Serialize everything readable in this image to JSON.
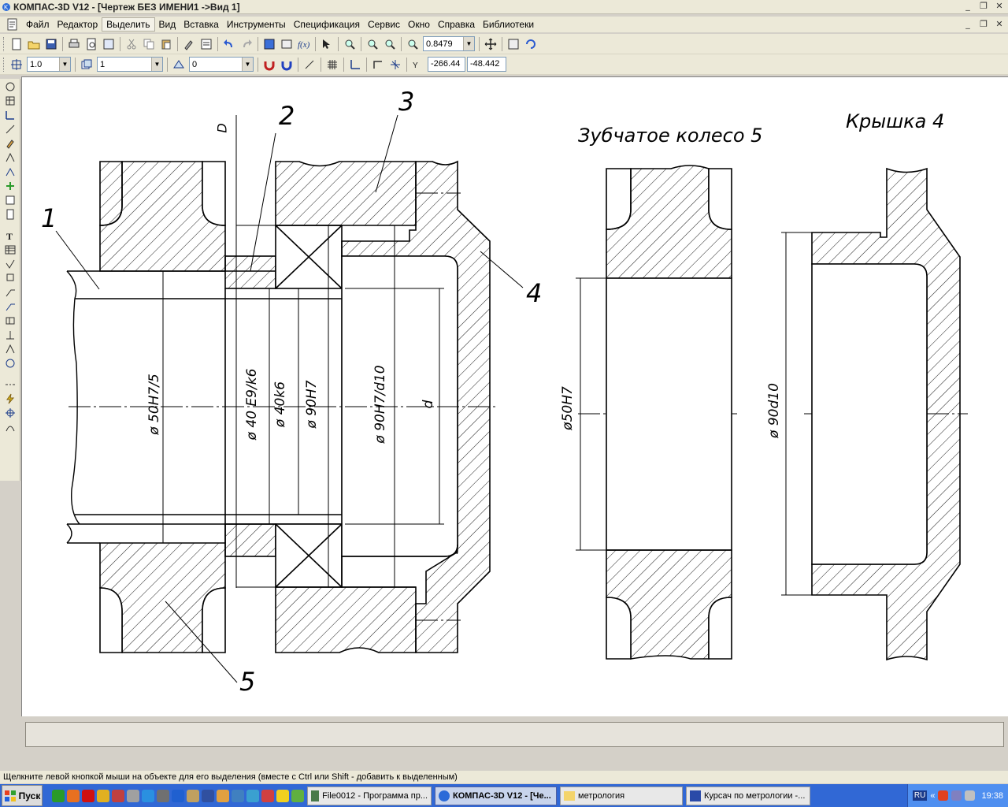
{
  "window": {
    "title": "КОМПАС-3D V12 - [Чертеж БЕЗ ИМЕНИ1 ->Вид 1]"
  },
  "menu": {
    "items": [
      "Файл",
      "Редактор",
      "Выделить",
      "Вид",
      "Вставка",
      "Инструменты",
      "Спецификация",
      "Сервис",
      "Окно",
      "Справка",
      "Библиотеки"
    ],
    "active_index": 2
  },
  "toolbar1": {
    "zoom_value": "0.8479"
  },
  "toolbar2": {
    "scale_value": "1.0",
    "layer_value": "1",
    "style_value": "0",
    "coord_x": "-266.44",
    "coord_y": "-48.442"
  },
  "drawing": {
    "callouts": [
      "1",
      "2",
      "3",
      "4",
      "5",
      "D"
    ],
    "dimensions_main": [
      "ø 50H7/5",
      "ø 40 E9/k6",
      "ø 40k6",
      "ø 90H7",
      "ø 90H7/d10",
      "d"
    ],
    "gear_title": "Зубчатое колесо 5",
    "gear_dimension": "ø50H7",
    "cover_title": "Крышка 4",
    "cover_dimension": "ø 90d10"
  },
  "status": {
    "hint": "Щелкните левой кнопкой мыши на объекте для его выделения (вместе с Ctrl или Shift - добавить к выделенным)"
  },
  "taskbar": {
    "start_label": "Пуск",
    "windows": [
      "File0012 - Программа пр...",
      "КОМПАС-3D V12 - [Че...",
      "метрология",
      "Курсач по метрологии -..."
    ],
    "active_window_index": 1,
    "lang": "RU",
    "clock": "19:38"
  }
}
